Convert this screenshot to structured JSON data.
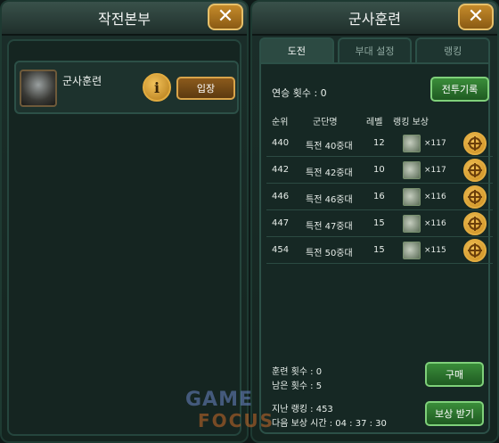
{
  "left_panel": {
    "title": "작전본부",
    "mission": {
      "name": "군사훈련",
      "info_label": "i",
      "enter_label": "입장"
    }
  },
  "right_panel": {
    "title": "군사훈련",
    "tabs": [
      {
        "label": "도전",
        "active": true
      },
      {
        "label": "부대 설정",
        "active": false
      },
      {
        "label": "랭킹",
        "active": false
      }
    ],
    "win_streak": "연승 횟수 : 0",
    "record_button": "전투기록",
    "headers": {
      "rank": "순위",
      "unit": "군단명",
      "level": "레벨",
      "reward": "랭킹 보상"
    },
    "rows": [
      {
        "rank": "440",
        "unit": "특전 40중대",
        "level": "12",
        "qty": "×117"
      },
      {
        "rank": "442",
        "unit": "특전 42중대",
        "level": "10",
        "qty": "×117"
      },
      {
        "rank": "446",
        "unit": "특전 46중대",
        "level": "16",
        "qty": "×116"
      },
      {
        "rank": "447",
        "unit": "특전 47중대",
        "level": "15",
        "qty": "×116"
      },
      {
        "rank": "454",
        "unit": "특전 50중대",
        "level": "15",
        "qty": "×115"
      }
    ],
    "training_count": "훈련 횟수 : 0",
    "remaining_count": "남은 횟수 : 5",
    "buy_button": "구매",
    "last_rank": "지난 랭킹 : 453",
    "next_reward_time": "다음 보상 시간 : 04 : 37 : 30",
    "reward_button": "보상 받기"
  },
  "close_glyph": "✕",
  "watermark": {
    "top": "GAME",
    "bottom": "FOCUS"
  },
  "colors": {
    "accent_gold": "#c58b2a",
    "button_green": "#3a8d3a",
    "panel_bg": "#152521"
  }
}
